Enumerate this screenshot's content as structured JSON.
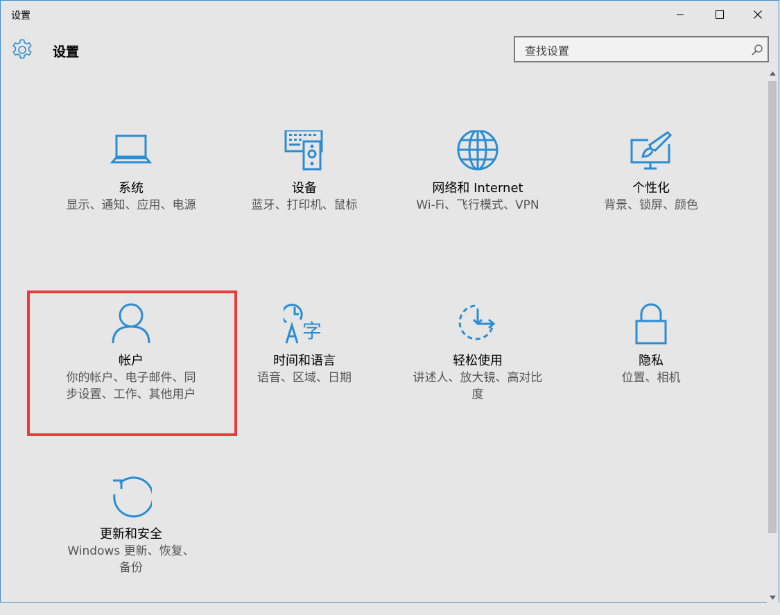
{
  "window": {
    "title": "设置",
    "minimize_icon": "minimize-icon",
    "maximize_icon": "maximize-icon",
    "close_icon": "close-icon"
  },
  "header": {
    "icon": "gear-icon",
    "title": "设置"
  },
  "search": {
    "placeholder": "查找设置",
    "value": "",
    "icon": "search-icon"
  },
  "colors": {
    "accent": "#2a8dd4",
    "highlight": "#f03a3a",
    "background": "#e6e6e6"
  },
  "categories": [
    {
      "name": "系统",
      "desc": "显示、通知、应用、电源",
      "icon": "laptop-icon"
    },
    {
      "name": "设备",
      "desc": "蓝牙、打印机、鼠标",
      "icon": "devices-icon"
    },
    {
      "name": "网络和 Internet",
      "desc": "Wi-Fi、飞行模式、VPN",
      "icon": "globe-icon"
    },
    {
      "name": "个性化",
      "desc": "背景、锁屏、颜色",
      "icon": "paintbrush-icon"
    },
    {
      "name": "帐户",
      "desc": "你的帐户、电子邮件、同步设置、工作、其他用户",
      "icon": "person-icon"
    },
    {
      "name": "时间和语言",
      "desc": "语音、区域、日期",
      "icon": "time-language-icon"
    },
    {
      "name": "轻松使用",
      "desc": "讲述人、放大镜、高对比度",
      "icon": "ease-of-access-icon"
    },
    {
      "name": "隐私",
      "desc": "位置、相机",
      "icon": "lock-icon"
    },
    {
      "name": "更新和安全",
      "desc": "Windows 更新、恢复、备份",
      "icon": "update-icon"
    }
  ]
}
